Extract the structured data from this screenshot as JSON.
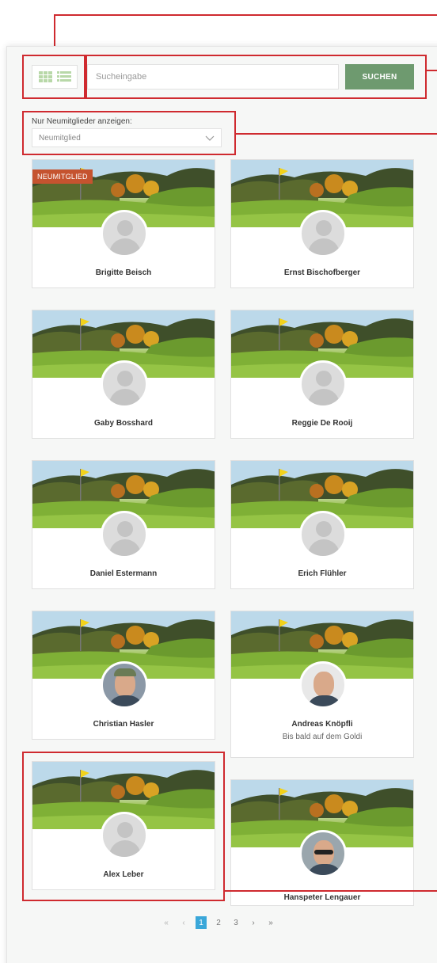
{
  "toolbar": {
    "search_placeholder": "Sucheingabe",
    "search_button": "SUCHEN"
  },
  "filter": {
    "label": "Nur Neumitglieder anzeigen:",
    "selected": "Neumitglied"
  },
  "badge_label": "NEUMITGLIED",
  "members": [
    {
      "name": "Brigitte Beisch",
      "subtitle": "",
      "avatar": "placeholder",
      "badge": true
    },
    {
      "name": "Ernst Bischofberger",
      "subtitle": "",
      "avatar": "placeholder",
      "badge": false
    },
    {
      "name": "Gaby Bosshard",
      "subtitle": "",
      "avatar": "placeholder",
      "badge": false
    },
    {
      "name": "Reggie De Rooij",
      "subtitle": "",
      "avatar": "placeholder",
      "badge": false
    },
    {
      "name": "Daniel Estermann",
      "subtitle": "",
      "avatar": "placeholder",
      "badge": false
    },
    {
      "name": "Erich Flühler",
      "subtitle": "",
      "avatar": "placeholder",
      "badge": false
    },
    {
      "name": "Christian Hasler",
      "subtitle": "",
      "avatar": "photo",
      "badge": false
    },
    {
      "name": "Andreas Knöpfli",
      "subtitle": "Bis bald auf dem Goldi",
      "avatar": "photo",
      "badge": false
    },
    {
      "name": "Alex Leber",
      "subtitle": "",
      "avatar": "placeholder",
      "badge": false
    },
    {
      "name": "Hanspeter Lengauer",
      "subtitle": "",
      "avatar": "photo",
      "badge": false
    }
  ],
  "pagination": {
    "first": "«",
    "prev": "‹",
    "pages": [
      "1",
      "2",
      "3"
    ],
    "current": "1",
    "next": "›",
    "last": "»"
  },
  "colors": {
    "accent_green": "#6e9a6f",
    "badge_red": "#c5532f",
    "annotation_red": "#cf2a2f",
    "page_active": "#3aa7d9"
  }
}
